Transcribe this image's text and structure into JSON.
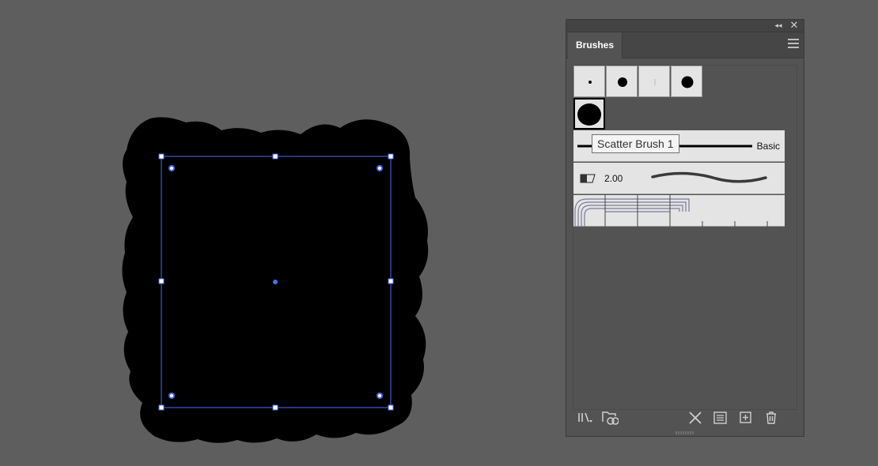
{
  "panel": {
    "title": "Brushes",
    "collapse_glyph": "◂◂",
    "close_glyph": "✕"
  },
  "tooltip": {
    "text": "Scatter Brush 1"
  },
  "brush_rows": {
    "basic_label": "Basic",
    "art_value": "2.00"
  },
  "icons": {
    "library": "brush-libraries-menu-icon",
    "cc_libraries": "creative-cloud-libraries-icon",
    "remove_stroke": "remove-brush-stroke-icon",
    "options": "brush-options-icon",
    "new": "new-brush-icon",
    "delete": "delete-brush-icon"
  },
  "colors": {
    "workspace": "#5e5e5e",
    "selection": "#4c6df0",
    "panel_bg": "#535353",
    "swatch_bg": "#e4e4e4"
  }
}
